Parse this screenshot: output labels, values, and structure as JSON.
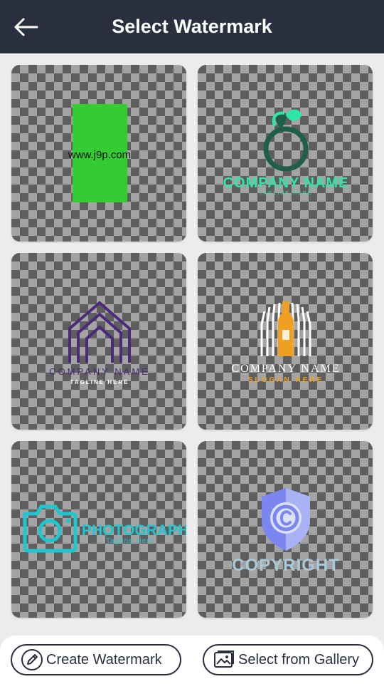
{
  "appbar": {
    "title": "Select Watermark",
    "back_icon": "arrow-left-icon",
    "background": "#2a2f3f"
  },
  "watermarks": [
    {
      "id": "w1",
      "text": "www.j9p.com",
      "colors": [
        "#33cc33",
        "#000000"
      ]
    },
    {
      "id": "w2",
      "line1": "COMPANY NAME",
      "line2": "TAGLINE HERE",
      "colors": [
        "#1f5f4a",
        "#2ee6a8"
      ]
    },
    {
      "id": "w3",
      "line1": "COMPANY NAME",
      "line2": "TAGLINE HERE",
      "colors": [
        "#4b2a7a",
        "#ffffff"
      ]
    },
    {
      "id": "w4",
      "line1": "COMPANY NAME",
      "line2": "SLOGAN HERE",
      "colors": [
        "#ffffff",
        "#f0a020"
      ]
    },
    {
      "id": "w5",
      "line1": "PHOTOGRAPHY",
      "line2": "Tagline Here",
      "colors": [
        "#1ec6cf"
      ]
    },
    {
      "id": "w6",
      "line1": "COPYRIGHT",
      "colors": [
        "#7b86f0",
        "#a9c9d9"
      ]
    }
  ],
  "actions": {
    "create_label": "Create Watermark",
    "create_icon": "pencil-icon",
    "gallery_label": "Select from Gallery",
    "gallery_icon": "image-icon"
  }
}
